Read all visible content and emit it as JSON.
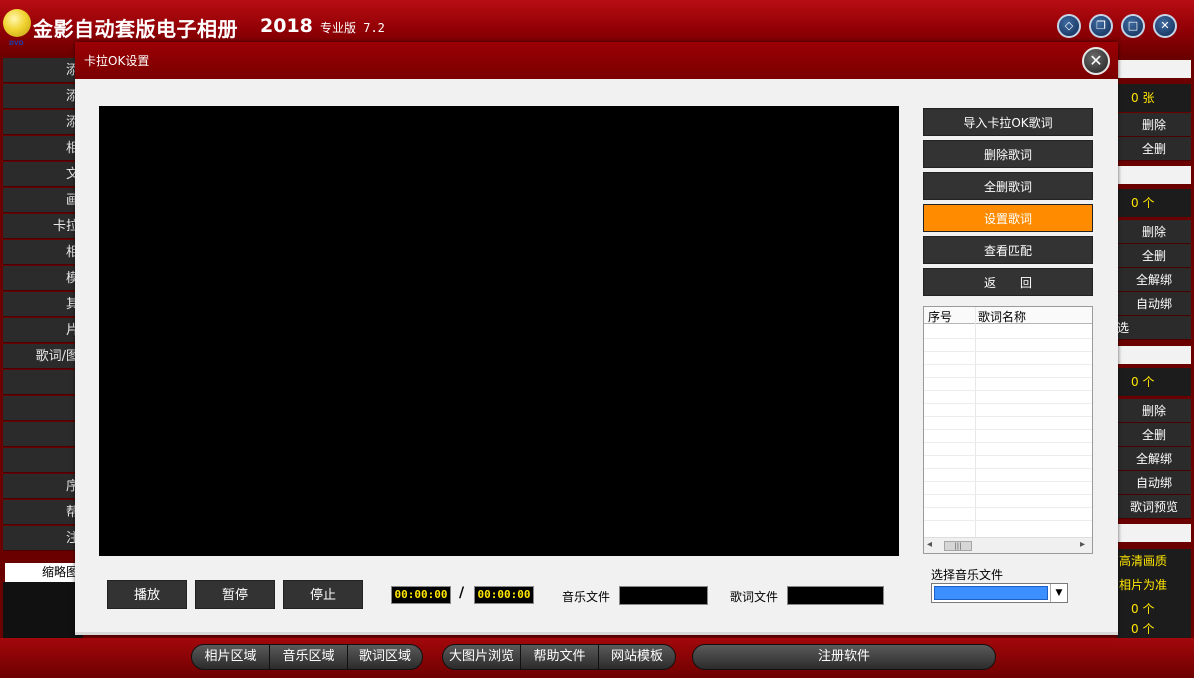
{
  "app": {
    "title": "金影自动套版电子相册",
    "year": "2018",
    "edition": "专业版 7.2",
    "logo_text": "DVD"
  },
  "window_controls": [
    "diamond-icon",
    "restore-icon",
    "maximize-icon",
    "close-icon"
  ],
  "left_panel": {
    "items": [
      "添",
      "添",
      "添",
      "相",
      "文",
      "画",
      "卡拉",
      "相",
      "模",
      "其",
      "片",
      "歌词/图",
      "",
      "",
      "",
      "",
      "序",
      "帮",
      "注"
    ],
    "thumb_tab": "缩略图"
  },
  "right_panel": {
    "photo_count": "0 张",
    "photo_buttons": [
      "删除",
      "全删"
    ],
    "music_count": "0 个",
    "music_buttons": [
      "删除",
      "全删",
      "全解绑",
      "自动绑"
    ],
    "music_extra": "选",
    "lyric_count": "0 个",
    "lyric_buttons": [
      "删除",
      "全删",
      "全解绑",
      "自动绑",
      "歌词预览"
    ],
    "quality": "高清画质",
    "photo_basis": "相片为准",
    "count_a": "0 个",
    "count_b": "0 个"
  },
  "bottom_bar": {
    "group1": [
      "相片区域",
      "音乐区域",
      "歌词区域"
    ],
    "group2": [
      "大图片浏览",
      "帮助文件",
      "网站模板"
    ],
    "register": "注册软件"
  },
  "dialog": {
    "title": "卡拉OK设置",
    "side_buttons": [
      {
        "label": "导入卡拉OK歌词",
        "active": false
      },
      {
        "label": "删除歌词",
        "active": false
      },
      {
        "label": "全删歌词",
        "active": false
      },
      {
        "label": "设置歌词",
        "active": true
      },
      {
        "label": "查看匹配",
        "active": false
      },
      {
        "label": "返　　回",
        "active": false
      }
    ],
    "list_columns": [
      "序号",
      "歌词名称"
    ],
    "playback_buttons": [
      "播放",
      "暂停",
      "停止"
    ],
    "current_time": "00:00:00",
    "time_separator": "/",
    "total_time": "00:00:00",
    "music_file_label": "音乐文件",
    "lyric_file_label": "歌词文件",
    "select_music_label": "选择音乐文件"
  },
  "colors": {
    "title_red": "#9b0004",
    "active_orange": "#ff8c00",
    "time_yellow": "#ffe600",
    "select_blue": "#3b8fff"
  }
}
